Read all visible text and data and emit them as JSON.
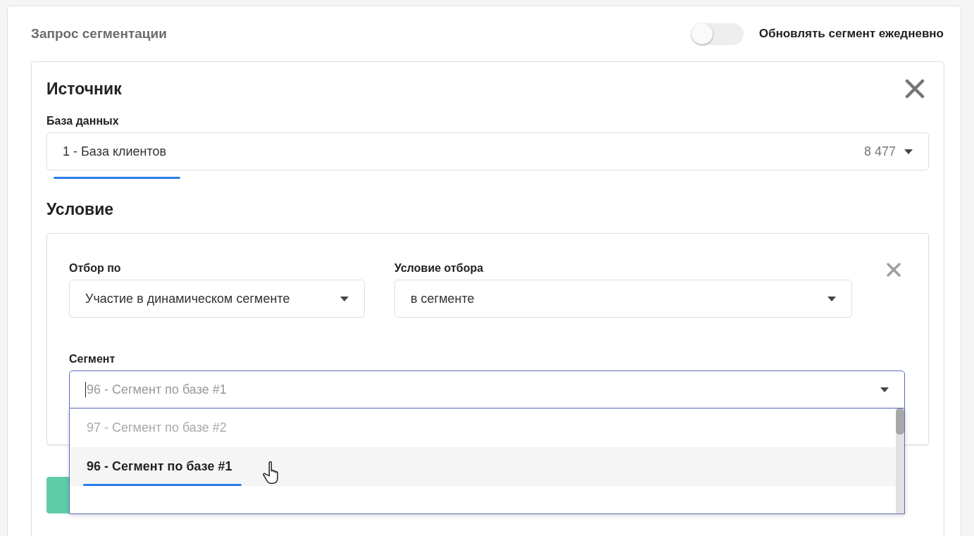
{
  "header": {
    "title": "Запрос сегментации",
    "toggle": {
      "label": "Обновлять сегмент ежедневно",
      "on": false
    }
  },
  "source": {
    "title": "Источник",
    "database": {
      "label": "База данных",
      "value": "1 - База клиентов",
      "count": "8 477"
    }
  },
  "condition": {
    "title": "Условие",
    "filter_by": {
      "label": "Отбор по",
      "value": "Участие в динамическом сегменте"
    },
    "filter_condition": {
      "label": "Условие отбора",
      "value": "в сегменте"
    },
    "segment": {
      "label": "Сегмент",
      "placeholder": "96 - Сегмент по базе #1",
      "expanded": true,
      "options": [
        {
          "label": "97 - Сегмент по базе #2",
          "selected": false
        },
        {
          "label": "96 - Сегмент по базе #1",
          "selected": true
        }
      ]
    }
  }
}
